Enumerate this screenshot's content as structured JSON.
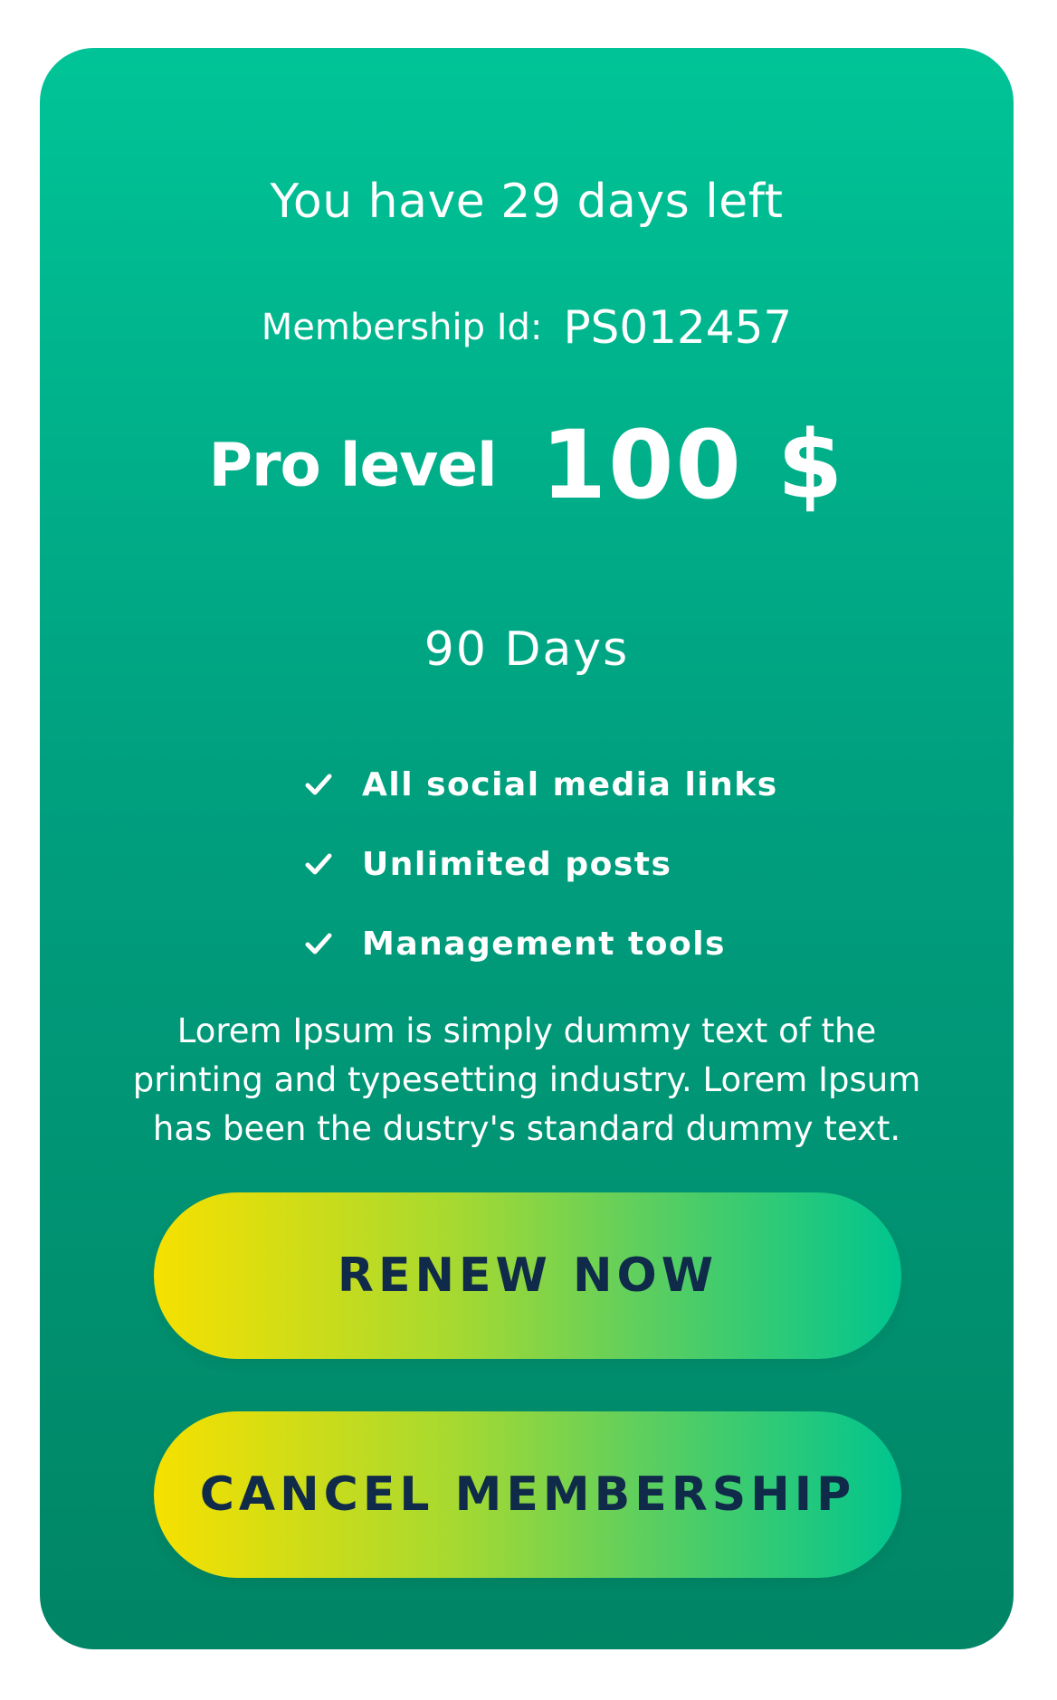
{
  "card": {
    "days_left_text": "You have 29 days left",
    "membership_label": "Membership Id:",
    "membership_id": "PS012457",
    "plan_name": "Pro level",
    "price": "100 $",
    "duration": "90 Days",
    "features": [
      {
        "icon": "check-icon",
        "label": "All social media links"
      },
      {
        "icon": "check-icon",
        "label": "Unlimited posts"
      },
      {
        "icon": "check-icon",
        "label": "Management tools"
      }
    ],
    "description": "Lorem Ipsum is simply dummy text of the printing and typesetting industry. Lorem Ipsum has been the dustry's standard dummy text."
  },
  "buttons": {
    "renew_label": "RENEW NOW",
    "cancel_label": "CANCEL MEMBERSHIP"
  },
  "colors": {
    "card_gradient_top": "#00c497",
    "card_gradient_bottom": "#008565",
    "button_gradient_left": "#f6e000",
    "button_gradient_right": "#00c58f",
    "button_text": "#102a4a",
    "text": "#ffffff"
  }
}
